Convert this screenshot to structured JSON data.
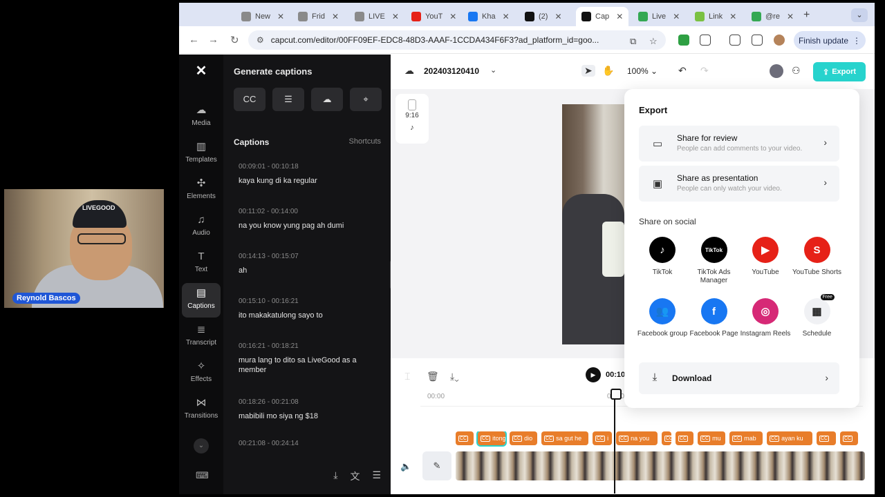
{
  "webcam": {
    "name": "Reynold Bascos",
    "cap_text": "LIVEGOOD"
  },
  "browser": {
    "tabs": [
      {
        "title": "New",
        "color": "#8a8a8a"
      },
      {
        "title": "Frid",
        "color": "#8a8a8a"
      },
      {
        "title": "LIVE",
        "color": "#8a8a8a"
      },
      {
        "title": "YouT",
        "color": "#e62117"
      },
      {
        "title": "Kha",
        "color": "#1877f2"
      },
      {
        "title": "(2)",
        "color": "#111111"
      },
      {
        "title": "Cap",
        "color": "#111111"
      },
      {
        "title": "Live",
        "color": "#34a853"
      },
      {
        "title": "Link",
        "color": "#7ac142"
      },
      {
        "title": "@re",
        "color": "#34a853"
      }
    ],
    "url": "capcut.com/editor/00FF09EF-EDC8-48D3-AAAF-1CCDA434F6F3?ad_platform_id=goo...",
    "finish_update": "Finish update"
  },
  "nav": {
    "items": [
      {
        "label": "Media",
        "icon": "☁"
      },
      {
        "label": "Templates",
        "icon": "▥"
      },
      {
        "label": "Elements",
        "icon": "✣"
      },
      {
        "label": "Audio",
        "icon": "♫"
      },
      {
        "label": "Text",
        "icon": "T"
      },
      {
        "label": "Captions",
        "icon": "▤"
      },
      {
        "label": "Transcript",
        "icon": "≣"
      },
      {
        "label": "Effects",
        "icon": "✧"
      },
      {
        "label": "Transitions",
        "icon": "⋈"
      }
    ]
  },
  "panel": {
    "title": "Generate captions",
    "tools": [
      "CC",
      "☰",
      "☁",
      "⌖"
    ],
    "captions_label": "Captions",
    "shortcuts_label": "Shortcuts",
    "captions": [
      {
        "time": "00:09:01 - 00:10:18",
        "text": "kaya kung di ka regular"
      },
      {
        "time": "00:11:02 - 00:14:00",
        "text": "na you know yung pag ah dumi"
      },
      {
        "time": "00:14:13 - 00:15:07",
        "text": "ah"
      },
      {
        "time": "00:15:10 - 00:16:21",
        "text": "ito makakatulong sayo to"
      },
      {
        "time": "00:16:21 - 00:18:21",
        "text": "mura lang to dito sa LiveGood as a member"
      },
      {
        "time": "00:18:26 - 00:21:08",
        "text": "mabibili mo siya ng $18"
      },
      {
        "time": "00:21:08 - 00:24:14",
        "text": ""
      }
    ]
  },
  "workspace": {
    "project_name": "202403120410",
    "zoom": "100%",
    "export_label": "Export",
    "ratio": "9:16"
  },
  "timeline": {
    "time_display": "00:10",
    "ruler": [
      "00:00",
      "00:10"
    ],
    "chips": [
      "",
      "itong",
      "dio",
      "sa gut he",
      "i",
      "na you",
      "",
      "",
      "mu",
      "mab",
      "ayan ku",
      "",
      ""
    ]
  },
  "export_popup": {
    "title": "Export",
    "share_review": {
      "title": "Share for review",
      "desc": "People can add comments to your video."
    },
    "share_presentation": {
      "title": "Share as presentation",
      "desc": "People can only watch your video."
    },
    "social_label": "Share on social",
    "social": [
      {
        "name": "TikTok",
        "color": "#000000",
        "glyph": "♪"
      },
      {
        "name": "TikTok Ads Manager",
        "color": "#000000",
        "glyph": "TikTok"
      },
      {
        "name": "YouTube",
        "color": "#e62117",
        "glyph": "▶"
      },
      {
        "name": "YouTube Shorts",
        "color": "#e62117",
        "glyph": "S"
      },
      {
        "name": "Facebook group",
        "color": "#1877f2",
        "glyph": "👥"
      },
      {
        "name": "Facebook Page",
        "color": "#1877f2",
        "glyph": "f"
      },
      {
        "name": "Instagram Reels",
        "color": "#d62976",
        "glyph": "◎"
      },
      {
        "name": "Schedule",
        "color": "#f0f1f4",
        "glyph": "▦"
      }
    ],
    "free_badge": "Free",
    "download": "Download"
  }
}
